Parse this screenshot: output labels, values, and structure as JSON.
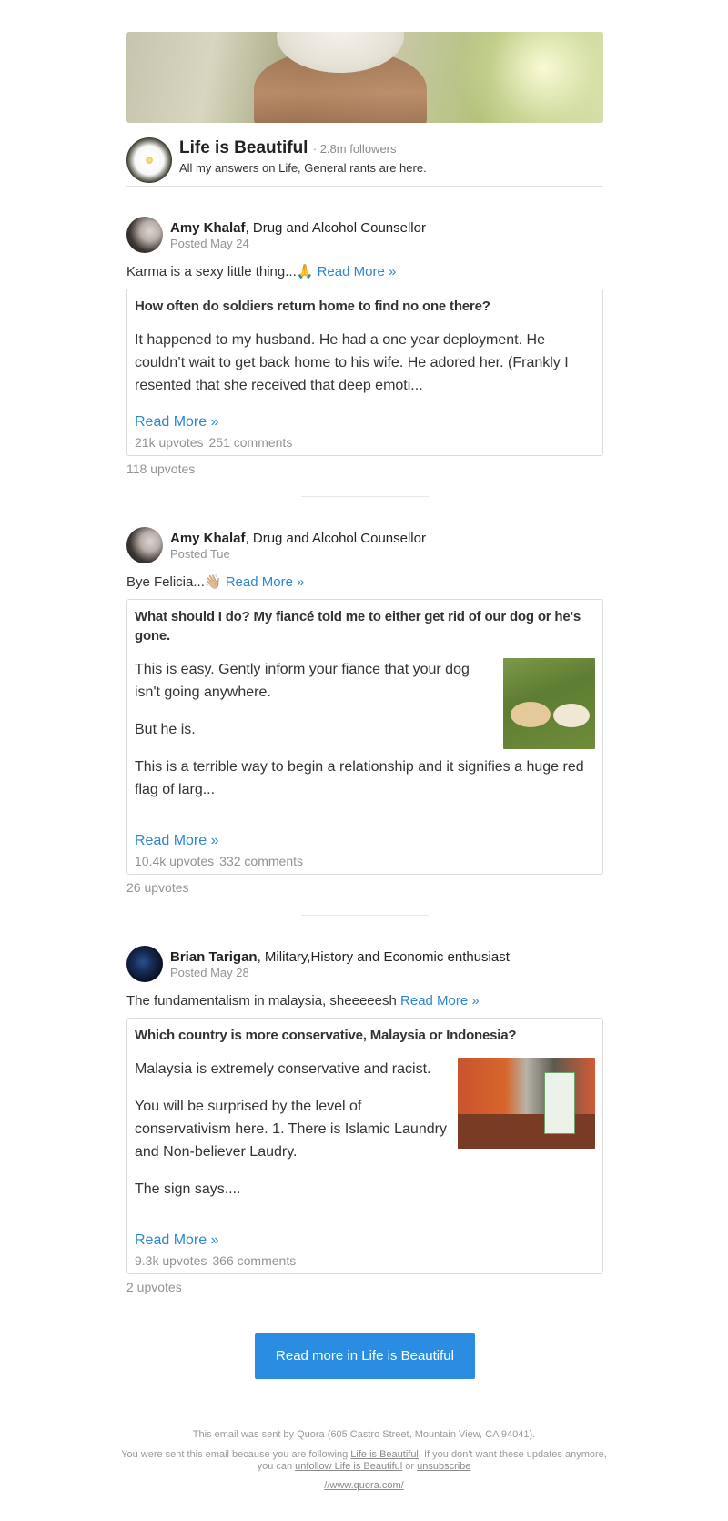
{
  "space": {
    "name": "Life is Beautiful",
    "followers": "· 2.8m followers",
    "description": "All my answers on Life, General rants are here."
  },
  "stories": [
    {
      "author_name": "Amy Khalaf",
      "author_cred": ", Drug and Alcohol Counsellor",
      "posted": "Posted May 24",
      "teaser": "Karma is a sexy little thing...🙏",
      "teaser_link": "Read More »",
      "question": "How often do soldiers return home to find no one there?",
      "body": [
        "It happened to my husband. He had a one year deployment. He couldn’t wait to get back home to his wife. He adored her. (Frankly I resented that she received that deep emoti..."
      ],
      "read_more": "Read More »",
      "card_upvotes": "21k upvotes",
      "card_comments": "251 comments",
      "share_upvotes": "118 upvotes"
    },
    {
      "author_name": "Amy Khalaf",
      "author_cred": ", Drug and Alcohol Counsellor",
      "posted": "Posted Tue",
      "teaser": "Bye Felicia...👋🏼",
      "teaser_link": "Read More »",
      "question": "What should I do? My fiancé told me to either get rid of our dog or he's gone.",
      "body": [
        "This is easy. Gently inform your fiance that your dog isn't going anywhere.",
        "But he is.",
        "This is a terrible way to begin a relationship and it signifies a huge red flag of larg..."
      ],
      "read_more": "Read More »",
      "card_upvotes": "10.4k upvotes",
      "card_comments": "332 comments",
      "share_upvotes": "26 upvotes"
    },
    {
      "author_name": "Brian Tarigan",
      "author_cred": ", Military,History and Economic enthusiast",
      "posted": "Posted May 28",
      "teaser": "The fundamentalism in malaysia, sheeeeesh",
      "teaser_link": "Read More »",
      "question": "Which country is more conservative, Malaysia or Indonesia?",
      "body": [
        "Malaysia is extremely conservative and racist.",
        "You will be surprised by the level of conservativism here. 1. There is Islamic Laundry and Non-believer Laudry.",
        "The sign says...."
      ],
      "read_more": "Read More »",
      "card_upvotes": "9.3k upvotes",
      "card_comments": "366 comments",
      "share_upvotes": "2 upvotes"
    }
  ],
  "cta_label": "Read more in Life is Beautiful",
  "footer": {
    "sent_by": "This email was sent by Quora (605 Castro Street, Mountain View, CA 94041).",
    "reason_a": "You were sent this email because you are following ",
    "reason_link": "Life is Beautiful",
    "reason_b": ". If you don't want these updates anymore, you can ",
    "unfollow_link": "unfollow Life is Beautiful",
    "reason_or": " or ",
    "unsubscribe_link": "unsubscribe",
    "site_link": "//www.quora.com/"
  },
  "colors": {
    "link": "#2b87d1",
    "cta": "#2b8de2",
    "muted": "#939393"
  }
}
